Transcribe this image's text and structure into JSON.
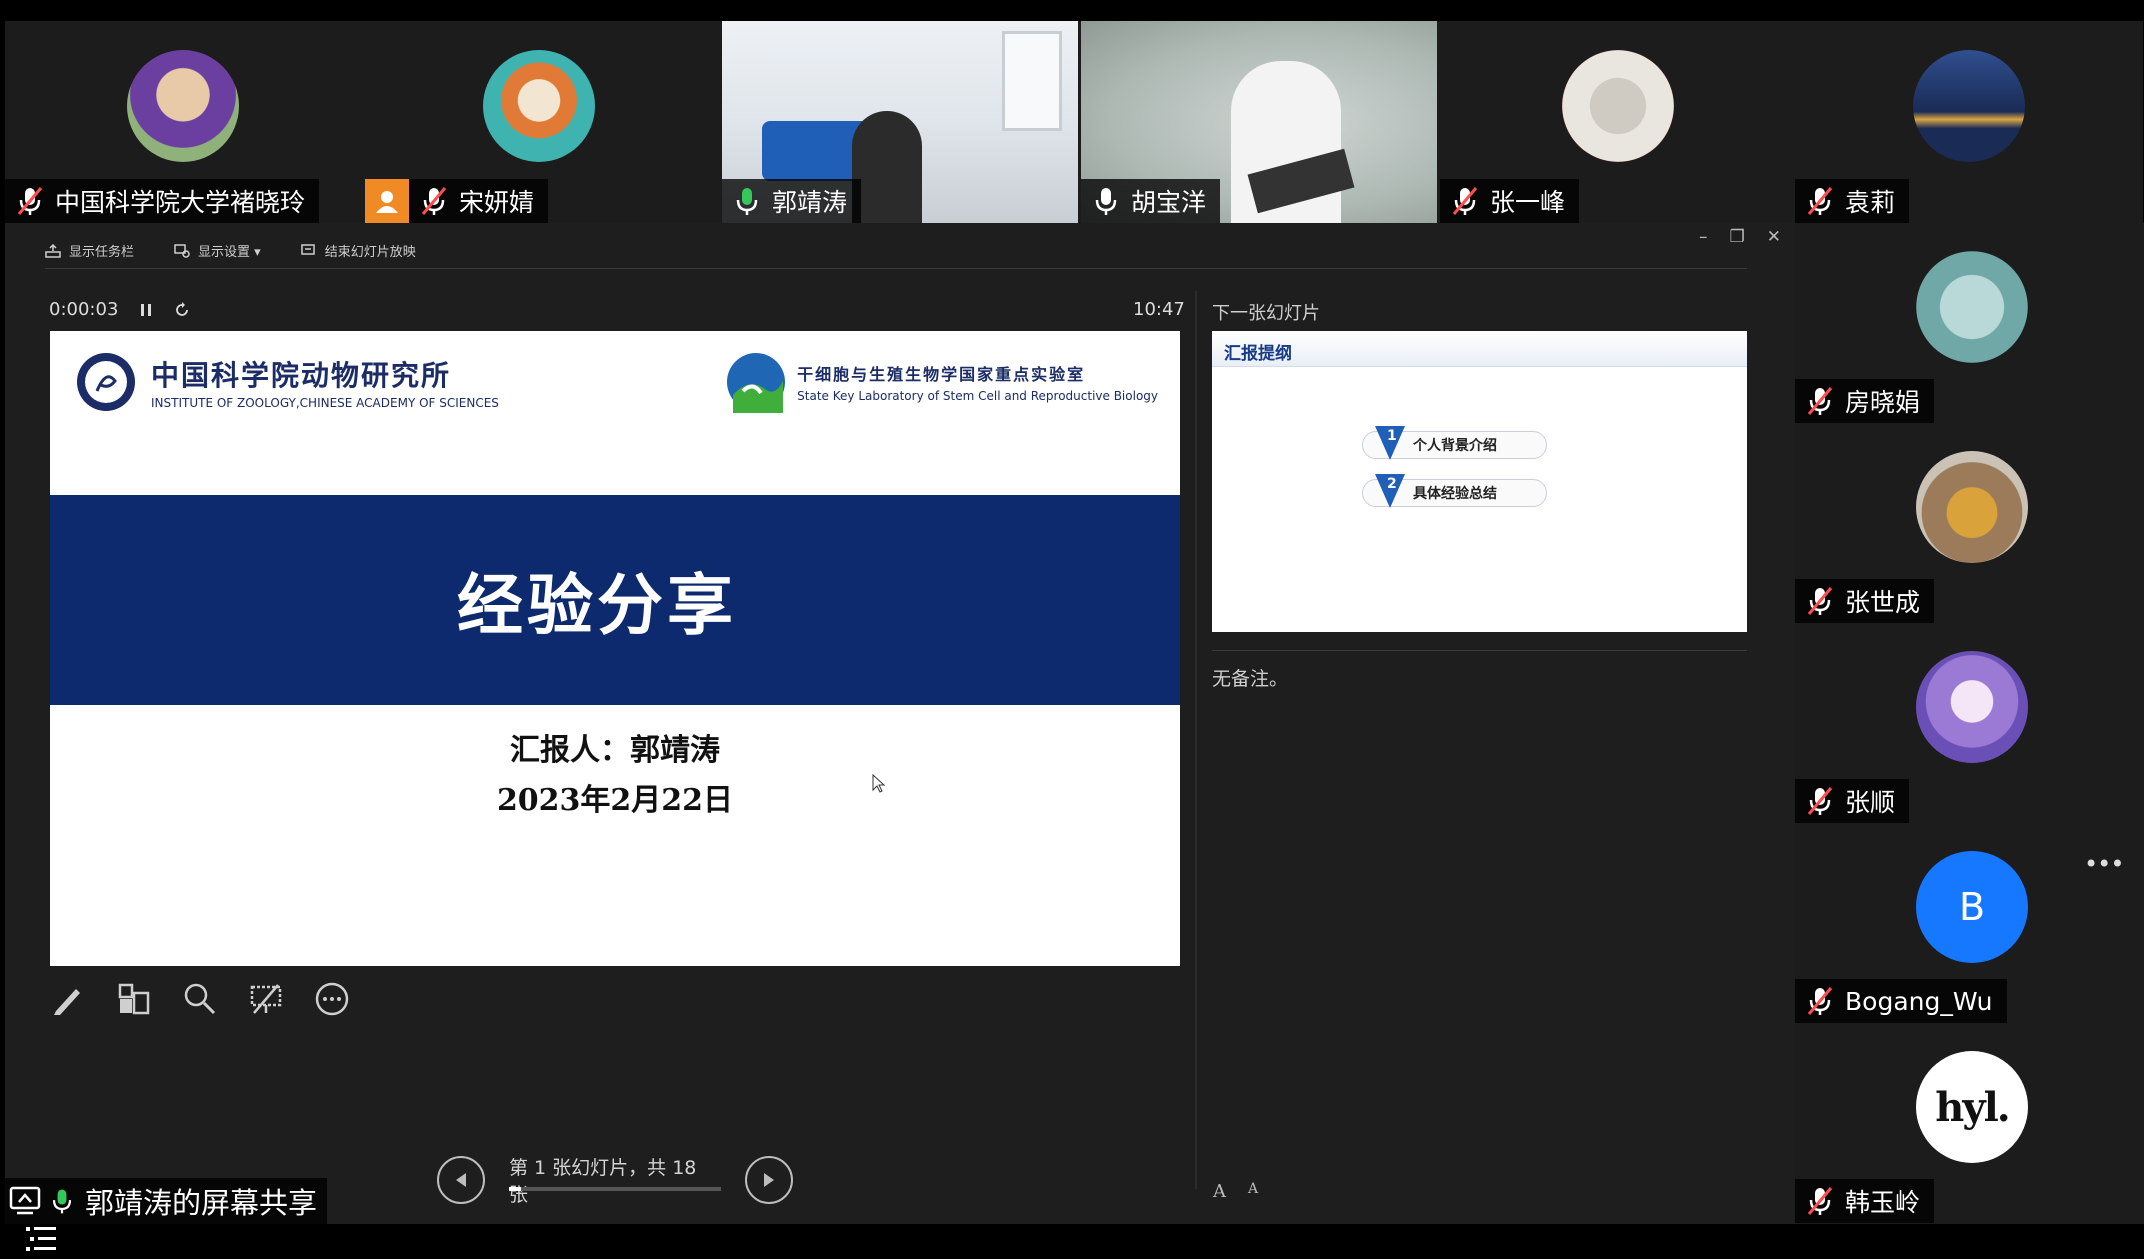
{
  "top_participants": [
    {
      "name": "中国科学院大学褚晓玲",
      "muted": true,
      "type": "avatar"
    },
    {
      "name": "宋妍婧",
      "muted": true,
      "type": "avatar",
      "has_profile_badge": true
    },
    {
      "name": "郭靖涛",
      "muted": false,
      "type": "video"
    },
    {
      "name": "胡宝洋",
      "muted": false,
      "type": "video"
    },
    {
      "name": "张一峰",
      "muted": true,
      "type": "avatar"
    },
    {
      "name": "袁莉",
      "muted": true,
      "type": "avatar"
    }
  ],
  "right_participants": [
    {
      "name": "房晓娟",
      "muted": true
    },
    {
      "name": "张世成",
      "muted": true
    },
    {
      "name": "张顺",
      "muted": true
    },
    {
      "name": "Bogang_Wu",
      "muted": true,
      "avatar_letter": "B"
    },
    {
      "name": "韩玉岭",
      "muted": true,
      "avatar_text": "hyl."
    }
  ],
  "presenter": {
    "toolbar": {
      "taskbar": "显示任务栏",
      "display_settings": "显示设置 ▾",
      "end_show": "结束幻灯片放映"
    },
    "window_controls": {
      "minimize": "–",
      "restore": "❐",
      "close": "✕"
    },
    "elapsed_time": "0:00:03",
    "clock": "10:47",
    "next_slide_label": "下一张幻灯片",
    "notes": "无备注。",
    "slide_counter": "第 1 张幻灯片，共 18 张",
    "progress_fraction": 0.055,
    "font_larger": "A",
    "font_smaller": "A"
  },
  "current_slide": {
    "institute_cn": "中国科学院动物研究所",
    "institute_en": "INSTITUTE OF ZOOLOGY,CHINESE ACADEMY OF SCIENCES",
    "lab_cn": "干细胞与生殖生物学国家重点实验室",
    "lab_en": "State Key Laboratory of Stem Cell and Reproductive Biology",
    "title": "经验分享",
    "reporter": "汇报人：郭靖涛",
    "date": "2023年2月22日"
  },
  "next_slide": {
    "heading": "汇报提纲",
    "items": [
      {
        "num": "1",
        "label": "个人背景介绍"
      },
      {
        "num": "2",
        "label": "具体经验总结"
      }
    ]
  },
  "screen_share_label": "郭靖涛的屏幕共享",
  "more_label": "•••",
  "colors": {
    "banner": "#0c2a6d",
    "panel_bg": "#1e1e1e",
    "tile_bg": "#1c1c1c",
    "accent_orange": "#f08a24",
    "mic_active": "#35c759",
    "mic_muted": "#ff4d4f"
  }
}
